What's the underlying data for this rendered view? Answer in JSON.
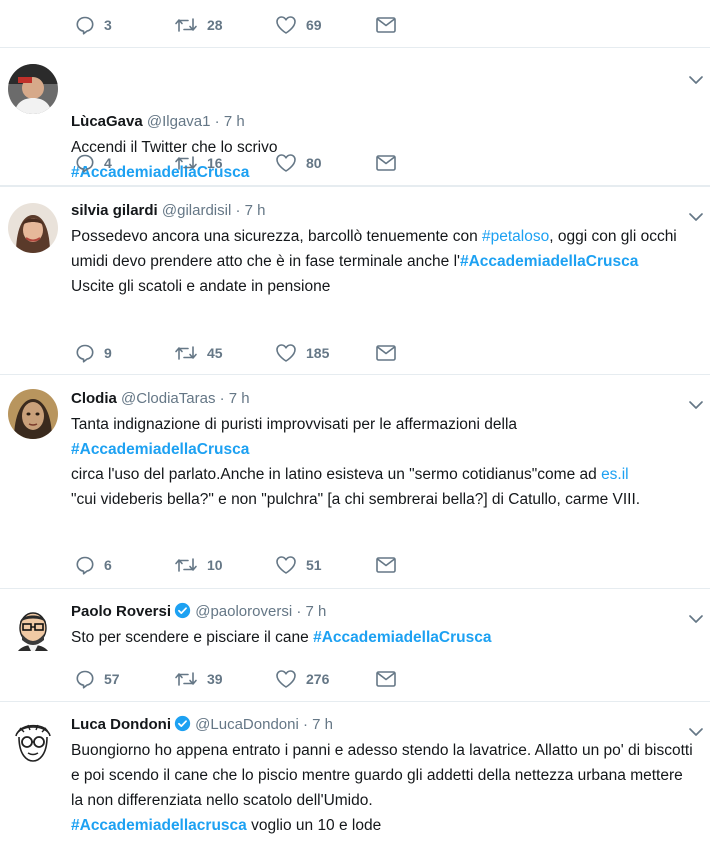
{
  "top_actions": {
    "reply": "3",
    "retweet": "28",
    "like": "69"
  },
  "tweets": [
    {
      "name": "LùcaGava",
      "handle": "@Ilgava1",
      "time": "7 h",
      "text1": "Accendi il Twitter che lo scrivo",
      "hashtag": "#AccademiadellaCrusca",
      "reply": "4",
      "retweet": "16",
      "like": "80"
    },
    {
      "name": "silvia gilardi",
      "handle": "@gilardisil",
      "time": "7 h",
      "text1": "Possedevo ancora una sicurezza, barcollò tenuemente con ",
      "hashtag1": "#petaloso",
      "text2": ", oggi con gli occhi umidi devo prendere atto che è in fase terminale anche l'",
      "hashtag2": "#AccademiadellaCrusca",
      "text3": "Uscite gli scatoli e andate in pensione",
      "reply": "9",
      "retweet": "45",
      "like": "185"
    },
    {
      "name": "Clodia",
      "handle": "@ClodiaTaras",
      "time": "7 h",
      "text1": "Tanta indignazione di puristi improvvisati per le affermazioni della",
      "hashtag": "#AccademiadellaCrusca",
      "text2": "circa l'uso del parlato.Anche in latino esisteva un \"sermo cotidianus\"come ad ",
      "link": "es.il",
      "text3": "\"cui videberis bella?\" e non \"pulchra\" [a chi sembrerai bella?] di Catullo, carme VIII.",
      "reply": "6",
      "retweet": "10",
      "like": "51"
    },
    {
      "name": "Paolo Roversi",
      "handle": "@paoloroversi",
      "time": "7 h",
      "text1": "Sto per scendere e pisciare il cane ",
      "hashtag": "#AccademiadellaCrusca",
      "reply": "57",
      "retweet": "39",
      "like": "276"
    },
    {
      "name": "Luca Dondoni",
      "handle": "@LucaDondoni",
      "time": "7 h",
      "text1": "Buongiorno ho appena entrato i panni e adesso stendo la lavatrice. Allatto un po' di biscotti e poi scendo il cane che lo piscio mentre guardo gli addetti della nettezza urbana mettere la non differenziata nello scatolo dell'Umido.",
      "hashtag": "#Accademiadellacrusca",
      "text2": " voglio un 10 e lode"
    }
  ],
  "colors": {
    "accent": "#1da1f2",
    "muted": "#657786",
    "divider": "#e6ecf0"
  },
  "icons": [
    "reply-icon",
    "retweet-icon",
    "like-icon",
    "message-icon",
    "chevron-down-icon",
    "verified-icon"
  ]
}
